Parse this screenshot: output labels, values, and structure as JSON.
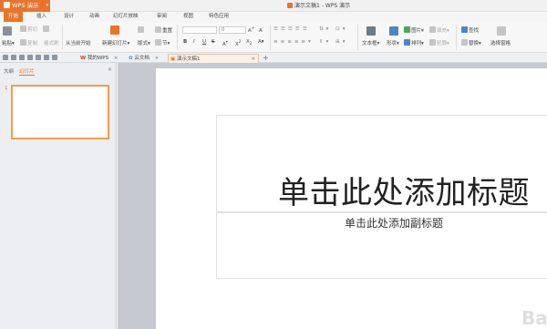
{
  "window": {
    "app_button": "WPS 演示",
    "title": "演示文稿1 - WPS 演示"
  },
  "menu": [
    "开始",
    "插入",
    "设计",
    "动画",
    "幻灯片放映",
    "审阅",
    "视图",
    "特色应用"
  ],
  "ribbon": {
    "paste": "粘贴",
    "cut": "剪切",
    "copy": "复制",
    "format_painter": "格式刷",
    "from_current": "从当前开始",
    "new_slide": "新建幻灯片",
    "layout": "版式",
    "reset": "重置",
    "section": "节",
    "font_size": "0",
    "bold": "B",
    "italic": "I",
    "underline": "U",
    "strike": "S",
    "text_box": "文本框",
    "shape": "形状",
    "picture": "图片",
    "fill": "填充",
    "arrange": "排列",
    "outline": "轮廓",
    "find": "查找",
    "replace": "替换",
    "select_pane": "选择窗格"
  },
  "tabs": {
    "my_wps": "我的WPS",
    "cloud_docs": "云文档",
    "doc": "演示文稿1",
    "close_glyph": "×",
    "new_glyph": "+"
  },
  "left_panel": {
    "outline_tab": "大纲",
    "slides_tab": "幻灯片",
    "close_glyph": "×",
    "slide_number": "1"
  },
  "slide": {
    "title_placeholder": "单击此处添加标题",
    "subtitle_placeholder": "单击此处添加副标题"
  },
  "watermark": "Ba",
  "colors": {
    "accent": "#e8742c",
    "thumb_border": "#f19d4f",
    "workspace": "#c6c9cf"
  }
}
